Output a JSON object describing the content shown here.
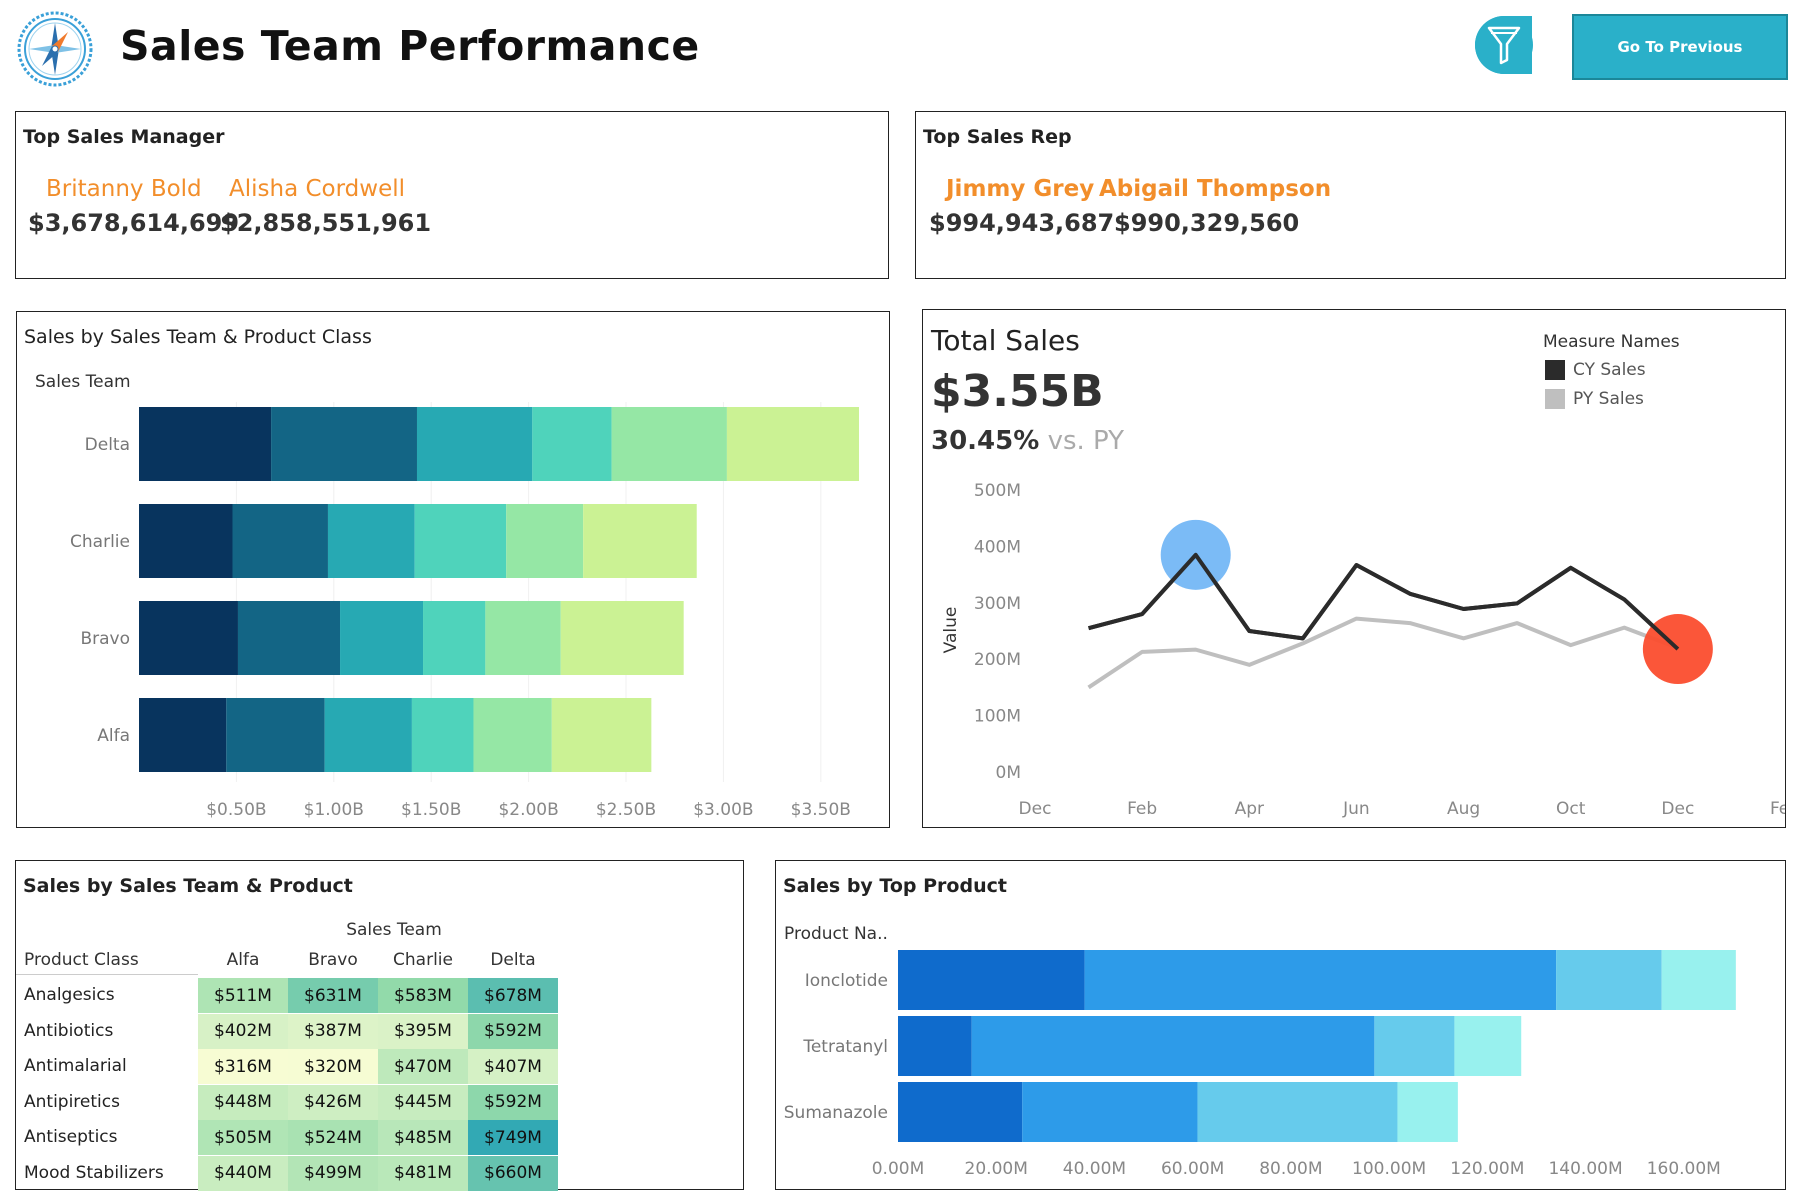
{
  "header": {
    "title": "Sales Team Performance",
    "logo_icon": "compass-icon",
    "filter_icon": "filter-icon",
    "prev_button_label": "Go To Previous"
  },
  "top_manager": {
    "title": "Top Sales Manager",
    "names": [
      "Britanny Bold",
      "Alisha Cordwell"
    ],
    "values": [
      "$3,678,614,699",
      "$2,858,551,961"
    ]
  },
  "top_rep": {
    "title": "Top Sales Rep",
    "names": [
      "Jimmy Grey",
      "Abigail Thompson"
    ],
    "values": [
      "$994,943,687",
      "$990,329,560"
    ]
  },
  "colors": {
    "kpi_name": "#f28e2b",
    "product_class_palette": [
      "#08345e",
      "#136585",
      "#27a9b3",
      "#4fd3bb",
      "#95e7a5",
      "#cbf294"
    ],
    "top_product_palette": [
      "#0f6bcc",
      "#2d9be9",
      "#66cbec",
      "#98f1ee"
    ],
    "cy_sales": "#2b2b2b",
    "py_sales": "#bfbfbf",
    "highlight_high": "#64aff5",
    "highlight_low": "#fb4d2e",
    "button_bg": "#2ab0c9"
  },
  "total_sales": {
    "title": "Total Sales",
    "value": "$3.55B",
    "pct_change": "30.45%",
    "vs_label": "vs. PY",
    "legend_title": "Measure Names",
    "legend": [
      "CY Sales",
      "PY Sales"
    ]
  },
  "chart_data": [
    {
      "id": "sales_by_team_class",
      "type": "bar",
      "orientation": "horizontal",
      "stacked": true,
      "title": "Sales by Sales Team & Product Class",
      "ylabel": "Sales Team",
      "categories": [
        "Delta",
        "Charlie",
        "Bravo",
        "Alfa"
      ],
      "series": [
        {
          "values": [
            0.678,
            0.48,
            0.508,
            0.448
          ]
        },
        {
          "values": [
            0.749,
            0.49,
            0.524,
            0.505
          ]
        },
        {
          "values": [
            0.592,
            0.445,
            0.426,
            0.448
          ]
        },
        {
          "values": [
            0.407,
            0.47,
            0.32,
            0.316
          ]
        },
        {
          "values": [
            0.592,
            0.395,
            0.387,
            0.402
          ]
        },
        {
          "values": [
            0.678,
            0.583,
            0.631,
            0.511
          ]
        }
      ],
      "xticks": [
        "$0.50B",
        "$1.00B",
        "$1.50B",
        "$2.00B",
        "$2.50B",
        "$3.00B",
        "$3.50B"
      ],
      "xtick_values": [
        0.5,
        1.0,
        1.5,
        2.0,
        2.5,
        3.0,
        3.5
      ],
      "xlim": [
        0,
        3.85
      ]
    },
    {
      "id": "total_sales_line",
      "type": "line",
      "ylabel": "Value",
      "x": [
        "Jan",
        "Feb",
        "Mar",
        "Apr",
        "May",
        "Jun",
        "Jul",
        "Aug",
        "Sep",
        "Oct",
        "Nov",
        "Dec"
      ],
      "x_positions": [
        0.5,
        1,
        1.5,
        2,
        2.5,
        3,
        3.5,
        4,
        4.5,
        5,
        5.5,
        6
      ],
      "series": [
        {
          "name": "CY Sales",
          "values": [
            255,
            280,
            385,
            250,
            237,
            367,
            316,
            289,
            299,
            362,
            306,
            218
          ]
        },
        {
          "name": "PY Sales",
          "values": [
            150,
            213,
            217,
            190,
            228,
            272,
            264,
            237,
            264,
            225,
            256,
            220
          ]
        }
      ],
      "highlights": [
        {
          "label": "max",
          "month": "Mar",
          "value": 385
        },
        {
          "label": "min",
          "month": "Dec",
          "value": 218
        }
      ],
      "yticks": [
        "0M",
        "100M",
        "200M",
        "300M",
        "400M",
        "500M"
      ],
      "ytick_values": [
        0,
        100,
        200,
        300,
        400,
        500
      ],
      "ylim": [
        0,
        500
      ],
      "xticks": [
        "Dec",
        "Feb",
        "Apr",
        "Jun",
        "Aug",
        "Oct",
        "Dec",
        "Feb"
      ],
      "xtick_positions": [
        0,
        1,
        2,
        3,
        4,
        5,
        6,
        7
      ]
    },
    {
      "id": "sales_by_team_product",
      "type": "heatmap",
      "title": "Sales by Sales Team & Product",
      "column_header": "Sales Team",
      "row_header": "Product Class",
      "columns": [
        "Alfa",
        "Bravo",
        "Charlie",
        "Delta"
      ],
      "rows": [
        "Analgesics",
        "Antibiotics",
        "Antimalarial",
        "Antipiretics",
        "Antiseptics",
        "Mood Stabilizers"
      ],
      "values": [
        [
          511,
          631,
          583,
          678
        ],
        [
          402,
          387,
          395,
          592
        ],
        [
          316,
          320,
          470,
          407
        ],
        [
          448,
          426,
          445,
          592
        ],
        [
          505,
          524,
          485,
          749
        ],
        [
          440,
          499,
          481,
          660
        ]
      ],
      "labels": [
        [
          "$511M",
          "$631M",
          "$583M",
          "$678M"
        ],
        [
          "$402M",
          "$387M",
          "$395M",
          "$592M"
        ],
        [
          "$316M",
          "$320M",
          "$470M",
          "$407M"
        ],
        [
          "$448M",
          "$426M",
          "$445M",
          "$592M"
        ],
        [
          "$505M",
          "$524M",
          "$485M",
          "$749M"
        ],
        [
          "$440M",
          "$499M",
          "$481M",
          "$660M"
        ]
      ],
      "color_range": [
        "#fdfed6",
        "#2ca6b5"
      ]
    },
    {
      "id": "sales_by_top_product",
      "type": "bar",
      "orientation": "horizontal",
      "stacked": true,
      "title": "Sales by Top Product",
      "ylabel": "Product Na..",
      "categories": [
        "Ionclotide",
        "Tetratanyl",
        "Sumanazole"
      ],
      "series": [
        {
          "values": [
            38.0,
            15.0,
            25.3
          ]
        },
        {
          "values": [
            96.0,
            82.0,
            35.7
          ]
        },
        {
          "values": [
            21.5,
            16.3,
            40.7
          ]
        },
        {
          "values": [
            15.1,
            13.6,
            12.3
          ]
        }
      ],
      "xticks": [
        "0.00M",
        "20.00M",
        "40.00M",
        "60.00M",
        "80.00M",
        "100.00M",
        "120.00M",
        "140.00M",
        "160.00M"
      ],
      "xtick_values": [
        0,
        20,
        40,
        60,
        80,
        100,
        120,
        140,
        160
      ],
      "xlim": [
        0,
        180
      ]
    }
  ]
}
